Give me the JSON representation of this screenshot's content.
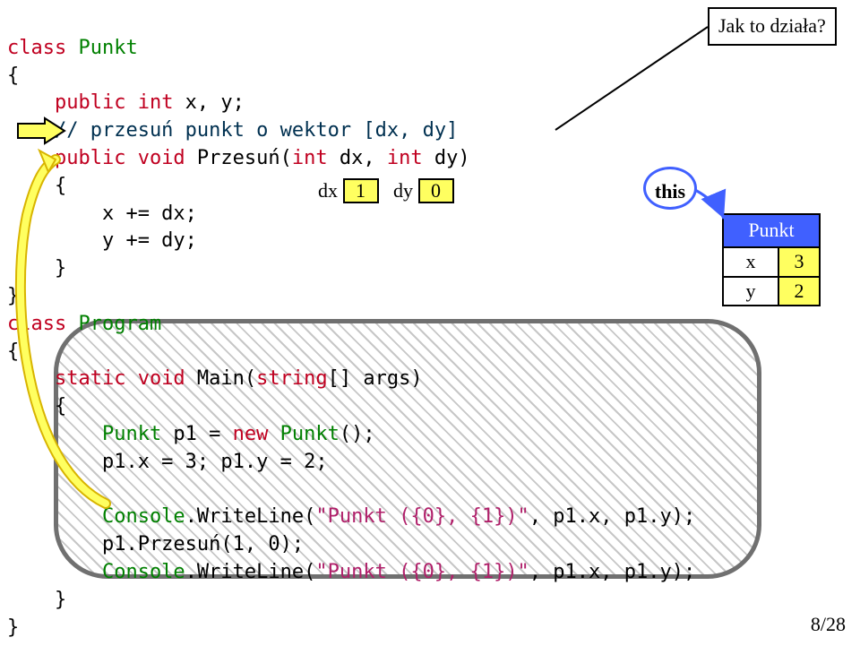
{
  "callout": "Jak to działa?",
  "code": {
    "l1_class": "class",
    "l1_name": "Punkt",
    "l2": "{",
    "l3_pub": "    public",
    "l3_int": " int",
    "l3_rest": " x, y;",
    "l4": "    // przesuń punkt o wektor [dx, dy]",
    "l5_pub": "    public",
    "l5_void": " void",
    "l5_name": " Przesuń(",
    "l5_int1": "int",
    "l5_p1": " dx,",
    "l5_int2": " int",
    "l5_p2": " dy)",
    "l6": "    {",
    "l7": "        x += dx;",
    "l8": "        y += dy;",
    "l9": "    }",
    "l10": "}",
    "l11_class": "class",
    "l11_name": " Program",
    "l12": "{",
    "l13_static": "    static",
    "l13_void": " void",
    "l13_name": " Main(",
    "l13_string": "string",
    "l13_rest": "[] args)",
    "l14": "    {",
    "l15a": "        Punkt",
    "l15b": " p1 = ",
    "l15_new": "new",
    "l15c": " Punkt",
    "l15d": "();",
    "l16": "        p1.x = 3; p1.y = 2;",
    "l17a": "        Console",
    "l17b": ".WriteLine(",
    "l17s": "\"Punkt ({0}, {1})\"",
    "l17c": ", p1.x, p1.y);",
    "l18": "        p1.Przesuń(1, 0);",
    "l19a": "        Console",
    "l19b": ".WriteLine(",
    "l19s": "\"Punkt ({0}, {1})\"",
    "l19c": ", p1.x, p1.y);",
    "l20": "    }",
    "l21": "}"
  },
  "locals": {
    "dx_label": "dx",
    "dx_value": "1",
    "dy_label": "dy",
    "dy_value": "0"
  },
  "this_label": "this",
  "object": {
    "title": "Punkt",
    "f1": "x",
    "v1": "3",
    "f2": "y",
    "v2": "2"
  },
  "page": "8/28"
}
